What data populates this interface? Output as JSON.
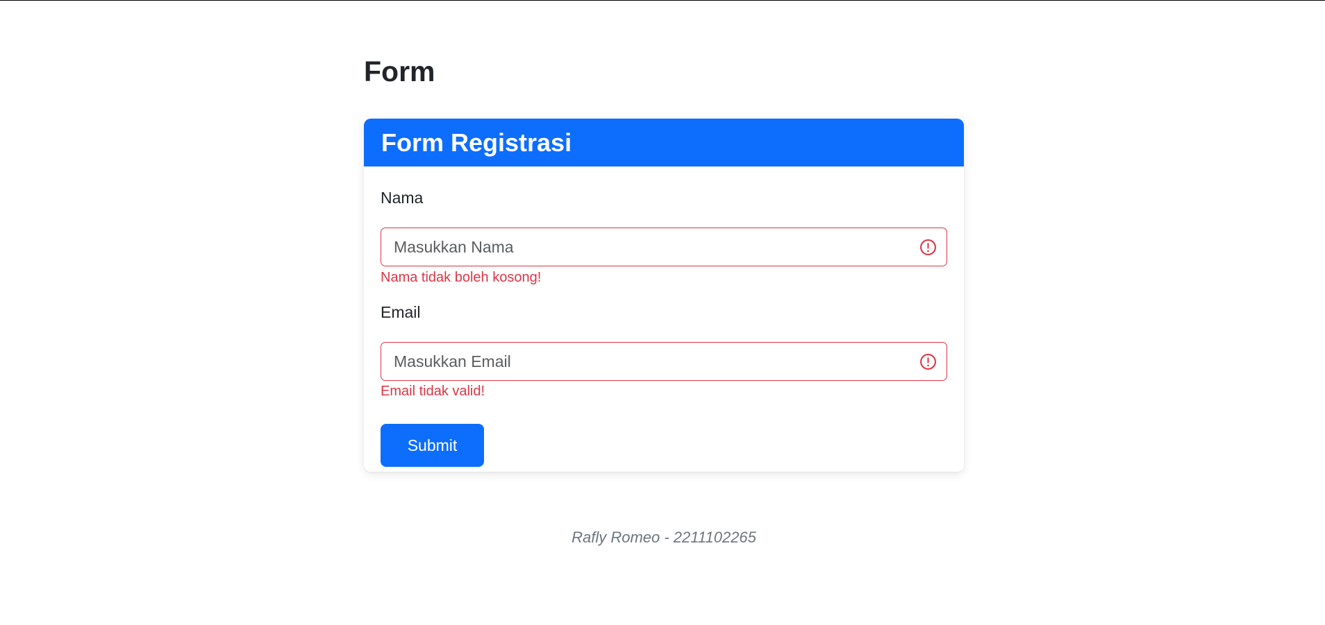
{
  "page": {
    "title": "Form"
  },
  "card": {
    "header_title": "Form Registrasi"
  },
  "form": {
    "nama": {
      "label": "Nama",
      "value": "",
      "placeholder": "Masukkan Nama",
      "error": "Nama tidak boleh kosong!"
    },
    "email": {
      "label": "Email",
      "value": "",
      "placeholder": "Masukkan Email",
      "error": "Email tidak valid!"
    },
    "submit_label": "Submit"
  },
  "footer": {
    "text": "Rafly Romeo - 2211102265"
  },
  "colors": {
    "primary": "#0d6efd",
    "danger": "#dc3545",
    "muted": "#6c757d",
    "text": "#212529"
  },
  "icons": {
    "invalid": "exclamation-circle-icon"
  }
}
